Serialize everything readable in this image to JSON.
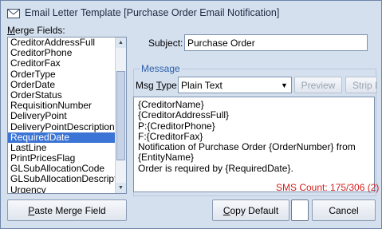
{
  "window": {
    "title": "Email Letter Template [Purchase Order Email Notification]"
  },
  "merge_fields": {
    "label_accel": "M",
    "label_rest": "erge Fields:",
    "items": [
      "CreditorAddressFull",
      "CreditorPhone",
      "CreditorFax",
      "OrderType",
      "OrderDate",
      "OrderStatus",
      "RequisitionNumber",
      "DeliveryPoint",
      "DeliveryPointDescription",
      "RequiredDate",
      "LastLine",
      "PrintPricesFlag",
      "GLSubAllocationCode",
      "GLSubAllocationDescription",
      "Urgency"
    ],
    "selected": "RequiredDate"
  },
  "subject": {
    "label": "Subject:",
    "value": "Purchase Order"
  },
  "message": {
    "group_label": "Message",
    "msg_type_label_pre": "Msg ",
    "msg_type_label_accel": "T",
    "msg_type_label_post": "ype:",
    "msg_type_value": "Plain Text",
    "preview_label": "Preview",
    "strip_label": "Strip H",
    "body": "{CreditorName}\n{CreditorAddressFull}\nP:{CreditorPhone}\nF:{CreditorFax}\nNotification of Purchase Order {OrderNumber} from\n{EntityName}\nOrder is required by {RequiredDate}.",
    "sms_count": "SMS Count: 175/306 (2)"
  },
  "buttons": {
    "paste_accel": "P",
    "paste_rest": "aste Merge Field",
    "copy_accel": "C",
    "copy_rest": "opy Default",
    "cancel": "Cancel"
  },
  "colors": {
    "window_bg": "#d5e0ef",
    "selection": "#3b74d4",
    "sms_count": "#d21e1e",
    "group_legend": "#2c5fa8"
  }
}
